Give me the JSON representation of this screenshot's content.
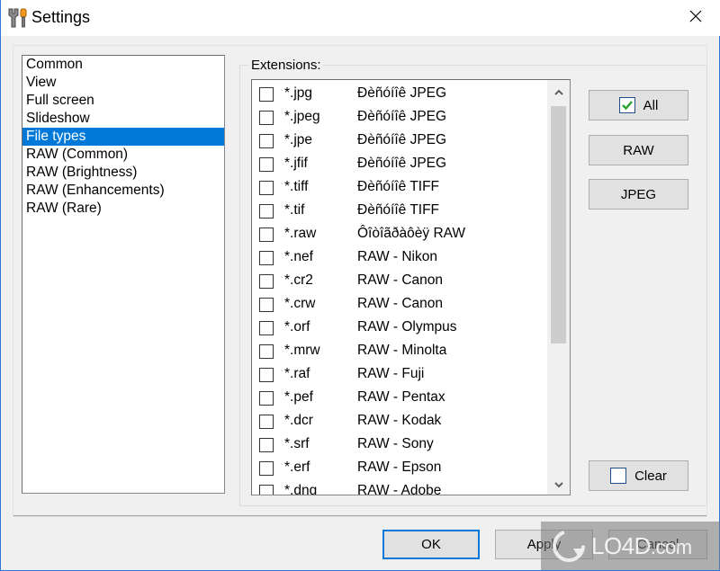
{
  "window": {
    "title": "Settings",
    "app_icon": "tools-icon",
    "close_icon": "close-icon"
  },
  "nav": {
    "selected_index": 4,
    "items": [
      {
        "label": "Common"
      },
      {
        "label": "View"
      },
      {
        "label": "Full screen"
      },
      {
        "label": "Slideshow"
      },
      {
        "label": "File types"
      },
      {
        "label": "RAW (Common)"
      },
      {
        "label": "RAW (Brightness)"
      },
      {
        "label": "RAW (Enhancements)"
      },
      {
        "label": "RAW (Rare)"
      }
    ]
  },
  "extensions": {
    "group_label": "Extensions:",
    "rows": [
      {
        "ext": "*.jpg",
        "desc": "Ðèñóíîê JPEG",
        "checked": false
      },
      {
        "ext": "*.jpeg",
        "desc": "Ðèñóíîê JPEG",
        "checked": false
      },
      {
        "ext": "*.jpe",
        "desc": "Ðèñóíîê JPEG",
        "checked": false
      },
      {
        "ext": "*.jfif",
        "desc": "Ðèñóíîê JPEG",
        "checked": false
      },
      {
        "ext": "*.tiff",
        "desc": "Ðèñóíîê TIFF",
        "checked": false
      },
      {
        "ext": "*.tif",
        "desc": "Ðèñóíîê TIFF",
        "checked": false
      },
      {
        "ext": "*.raw",
        "desc": "Ôîòîãðàôèÿ RAW",
        "checked": false
      },
      {
        "ext": "*.nef",
        "desc": "RAW - Nikon",
        "checked": false
      },
      {
        "ext": "*.cr2",
        "desc": "RAW - Canon",
        "checked": false
      },
      {
        "ext": "*.crw",
        "desc": "RAW - Canon",
        "checked": false
      },
      {
        "ext": "*.orf",
        "desc": "RAW - Olympus",
        "checked": false
      },
      {
        "ext": "*.mrw",
        "desc": "RAW - Minolta",
        "checked": false
      },
      {
        "ext": "*.raf",
        "desc": "RAW - Fuji",
        "checked": false
      },
      {
        "ext": "*.pef",
        "desc": "RAW - Pentax",
        "checked": false
      },
      {
        "ext": "*.dcr",
        "desc": "RAW - Kodak",
        "checked": false
      },
      {
        "ext": "*.srf",
        "desc": "RAW - Sony",
        "checked": false
      },
      {
        "ext": "*.erf",
        "desc": "RAW - Epson",
        "checked": false
      },
      {
        "ext": "*.dng",
        "desc": "RAW - Adobe",
        "checked": false
      }
    ]
  },
  "side_buttons": {
    "all_label": "All",
    "all_checked": true,
    "raw_label": "RAW",
    "jpeg_label": "JPEG",
    "clear_label": "Clear",
    "clear_checked": false
  },
  "footer": {
    "ok_label": "OK",
    "apply_label": "Apply",
    "cancel_label": "Cancel"
  },
  "watermark": {
    "text_main": "LO4D",
    "text_suffix": ".com"
  },
  "colors": {
    "selection": "#0078d7",
    "window_border": "#2b79d6",
    "check_green": "#2aa12a"
  }
}
